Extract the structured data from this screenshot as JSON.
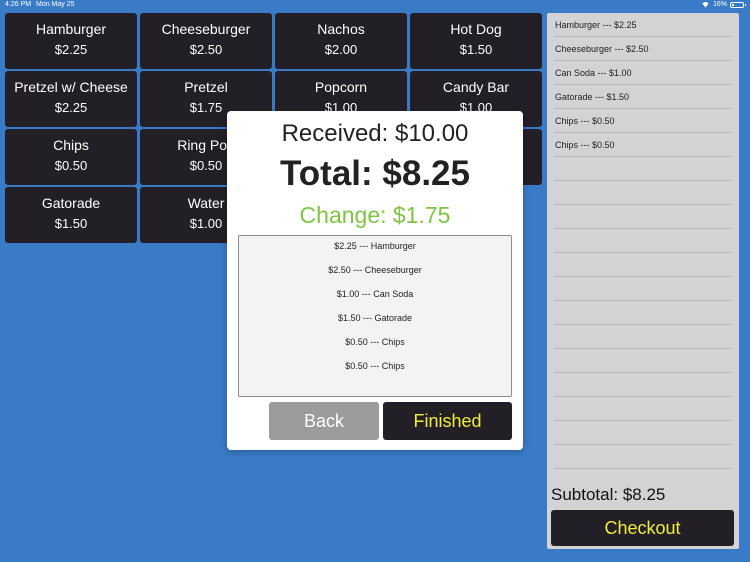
{
  "status": {
    "time": "4:26 PM",
    "date": "Mon May 25",
    "battery": "16%"
  },
  "menu": [
    {
      "name": "Hamburger",
      "price": "$2.25"
    },
    {
      "name": "Cheeseburger",
      "price": "$2.50"
    },
    {
      "name": "Nachos",
      "price": "$2.00"
    },
    {
      "name": "Hot Dog",
      "price": "$1.50"
    },
    {
      "name": "Pretzel w/ Cheese",
      "price": "$2.25"
    },
    {
      "name": "Pretzel",
      "price": "$1.75"
    },
    {
      "name": "Popcorn",
      "price": "$1.00"
    },
    {
      "name": "Candy Bar",
      "price": "$1.00"
    },
    {
      "name": "Chips",
      "price": "$0.50"
    },
    {
      "name": "Ring Pop",
      "price": "$0.50"
    },
    {
      "name": "Gatorade",
      "price": "$1.50"
    },
    {
      "name": "Water",
      "price": "$1.00"
    }
  ],
  "order": {
    "items": [
      "Hamburger --- $2.25",
      "Cheeseburger --- $2.50",
      "Can Soda --- $1.00",
      "Gatorade --- $1.50",
      "Chips --- $0.50",
      "Chips --- $0.50"
    ],
    "subtotal": "Subtotal: $8.25",
    "checkout": "Checkout"
  },
  "modal": {
    "received": "Received: $10.00",
    "total": "Total: $8.25",
    "change": "Change: $1.75",
    "lines": [
      "$2.25 --- Hamburger",
      "$2.50 --- Cheeseburger",
      "$1.00 --- Can Soda",
      "$1.50 --- Gatorade",
      "$0.50 --- Chips",
      "$0.50 --- Chips"
    ],
    "back": "Back",
    "finished": "Finished"
  },
  "colors": {
    "background": "#3a7bc8",
    "tile": "#231f26",
    "accent_yellow": "#f2ec3a",
    "change_green": "#7dc542"
  }
}
